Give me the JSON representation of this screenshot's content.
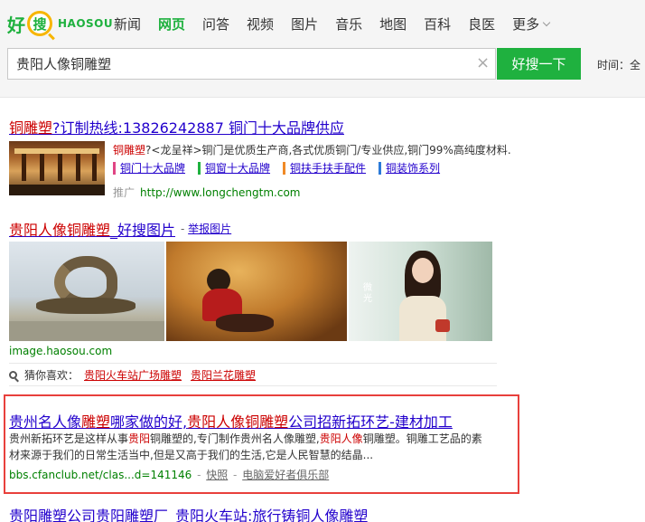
{
  "logo": {
    "hao": "好",
    "sou": "搜",
    "en": "HAOSOU"
  },
  "nav": [
    {
      "label": "新闻",
      "active": false
    },
    {
      "label": "网页",
      "active": true
    },
    {
      "label": "问答",
      "active": false
    },
    {
      "label": "视频",
      "active": false
    },
    {
      "label": "图片",
      "active": false
    },
    {
      "label": "音乐",
      "active": false
    },
    {
      "label": "地图",
      "active": false
    },
    {
      "label": "百科",
      "active": false
    },
    {
      "label": "良医",
      "active": false
    },
    {
      "label": "更多",
      "active": false
    }
  ],
  "search": {
    "value": "贵阳人像铜雕塑",
    "button": "好搜一下",
    "clear": "×",
    "time_label": "时间：全"
  },
  "results": [
    {
      "title_em": "铜雕塑",
      "title_rest": "?订制热线:13826242887 铜门十大品牌供应",
      "desc_em": "铜雕塑",
      "desc_rest": "?<龙呈祥>铜门是优质生产商,各式优质铜门/专业供应,铜门99%高纯度材料.",
      "sitelinks": [
        "铜门十大品牌",
        "铜窗十大品牌",
        "铜扶手扶手配件",
        "铜装饰系列"
      ],
      "ad_label": "推广",
      "url": "http://www.longchengtm.com"
    },
    {
      "title_em": "贵阳人像铜雕塑",
      "title_rest": "_好搜图片",
      "report_sep": " - ",
      "report": "举报图片",
      "image_labels": [
        "微",
        "光"
      ],
      "source": "image.haosou.com",
      "guess_label": "猜你喜欢：",
      "guesses": [
        "贵阳火车站广场雕塑",
        "贵阳兰花雕塑"
      ]
    },
    {
      "t1": "贵州名人像",
      "t2": "雕塑",
      "t3": "哪家做的好,",
      "t4": "贵阳人像铜雕塑",
      "t5": "公司招新拓环艺-建材加工",
      "d1": "贵州新拓环艺是这样从事",
      "d2": "贵阳",
      "d3": "铜雕塑的,专门制作贵州名人像雕塑,",
      "d4": "贵阳人像",
      "d5": "铜雕塑。铜雕工艺品的素材来源于我们的日常生活当中,但是又高于我们的生活,它是人民智慧的结晶...",
      "url": "bbs.cfanclub.net/clas...d=141146",
      "snapshot": "快照",
      "forum": "电脑爱好者俱乐部",
      "sep": " - "
    },
    {
      "title": "贵阳雕塑公司贵阳雕塑厂_贵阳火车站:旅行铸铜人像雕塑"
    }
  ],
  "colors": {
    "brand": "#1fb13f",
    "link": "#2200cc",
    "em": "#cc0000",
    "url": "#008000",
    "highlight": "#e8403c"
  }
}
